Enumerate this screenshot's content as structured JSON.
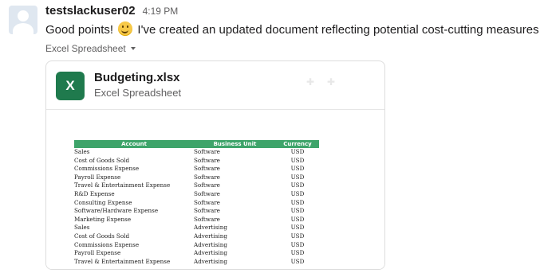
{
  "message": {
    "username": "testslackuser02",
    "timestamp": "4:19 PM",
    "text_before_emoji": "Good points!",
    "emoji": "slightly-smiling-face",
    "text_after_emoji": "I've created an updated document reflecting potential cost-cutting measures:",
    "attachment_label": "Excel Spreadsheet"
  },
  "file": {
    "icon_letter": "X",
    "icon_color": "#1f7a4d",
    "name": "Budgeting.xlsx",
    "type": "Excel Spreadsheet"
  },
  "sheet": {
    "header_color": "#3ea46a",
    "columns": [
      "Account",
      "Business Unit",
      "Currency"
    ],
    "rows": [
      [
        "Sales",
        "Software",
        "USD"
      ],
      [
        "Cost of Goods Sold",
        "Software",
        "USD"
      ],
      [
        "Commissions Expense",
        "Software",
        "USD"
      ],
      [
        "Payroll Expense",
        "Software",
        "USD"
      ],
      [
        "Travel & Entertainment Expense",
        "Software",
        "USD"
      ],
      [
        "R&D Expense",
        "Software",
        "USD"
      ],
      [
        "Consulting Expense",
        "Software",
        "USD"
      ],
      [
        "Software/Hardware Expense",
        "Software",
        "USD"
      ],
      [
        "Marketing Expense",
        "Software",
        "USD"
      ],
      [
        "Sales",
        "Advertising",
        "USD"
      ],
      [
        "Cost of Goods Sold",
        "Advertising",
        "USD"
      ],
      [
        "Commissions Expense",
        "Advertising",
        "USD"
      ],
      [
        "Payroll Expense",
        "Advertising",
        "USD"
      ],
      [
        "Travel & Entertainment Expense",
        "Advertising",
        "USD"
      ]
    ]
  }
}
